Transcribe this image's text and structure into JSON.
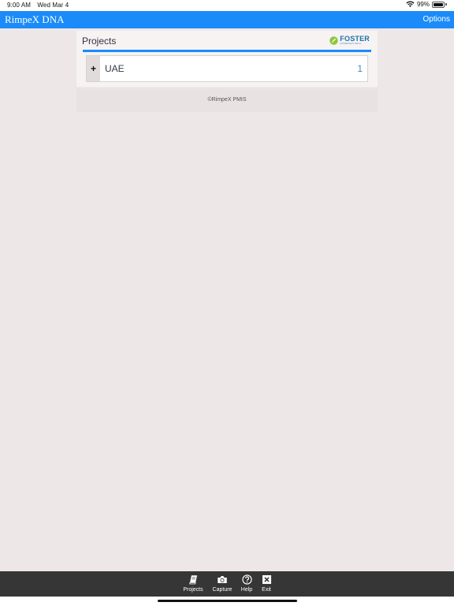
{
  "status_bar": {
    "time": "9:00 AM",
    "date": "Wed Mar 4",
    "battery": "99%",
    "battery_level": 0.99,
    "icons": [
      "wifi-icon",
      "battery-icon"
    ]
  },
  "nav": {
    "title": "RimpeX DNA",
    "options_label": "Options",
    "accent_color": "#1a8bf9"
  },
  "projects": {
    "title": "Projects",
    "logo": {
      "name": "FOSTER",
      "tagline": "INTERNATIONAL",
      "icon": "leaf-icon"
    },
    "rows": [
      {
        "expand_symbol": "+",
        "name": "UAE",
        "count": "1"
      }
    ]
  },
  "footer": {
    "copyright": "©RimpeX PMIS"
  },
  "tab_bar": {
    "tabs": [
      {
        "label": "Projects",
        "icon": "book-icon"
      },
      {
        "label": "Capture",
        "icon": "camera-icon"
      },
      {
        "label": "Help",
        "icon": "help-icon"
      },
      {
        "label": "Exit",
        "icon": "close-box-icon"
      }
    ]
  }
}
